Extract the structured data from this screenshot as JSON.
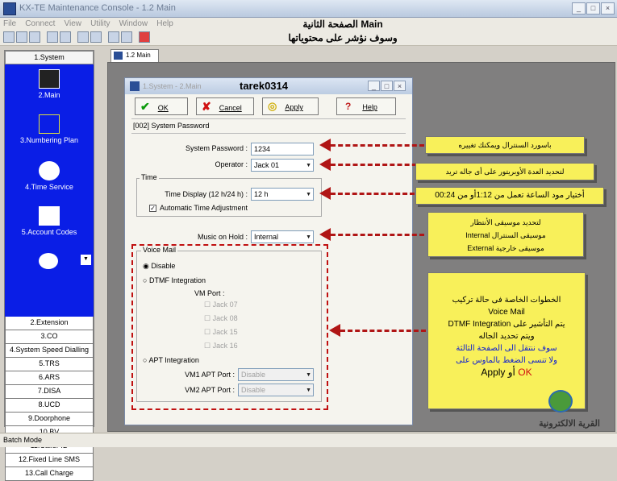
{
  "window": {
    "title": "KX-TE Maintenance Console - 1.2 Main"
  },
  "menu": [
    "File",
    "Connect",
    "View",
    "Utility",
    "Window",
    "Help"
  ],
  "overlay": {
    "line1": "الصفحة الثانية Main",
    "line2": "وسوف نؤشر على محتوياتها"
  },
  "sidebar": {
    "header": "1.System",
    "blue_items": [
      "2.Main",
      "3.Numbering Plan",
      "4.Time Service",
      "5.Account Codes"
    ],
    "list_items": [
      "2.Extension",
      "3.CO",
      "4.System Speed Dialling",
      "5.TRS",
      "6.ARS",
      "7.DISA",
      "8.UCD",
      "9.Doorphone",
      "10.BV",
      "11.Caller ID",
      "12.Fixed Line SMS",
      "13.Call Charge"
    ]
  },
  "tab": {
    "label": "1.2 Main"
  },
  "dialog": {
    "title": "1.System - 2.Main",
    "user": "tarek0314",
    "buttons": {
      "ok": "OK",
      "cancel": "Cancel",
      "apply": "Apply",
      "help": "Help"
    },
    "section": "[002] System Password",
    "system_password": {
      "label": "System Password :",
      "value": "1234"
    },
    "operator": {
      "label": "Operator :",
      "value": "Jack 01"
    },
    "time_group": "Time",
    "time_display": {
      "label": "Time Display (12 h/24 h) :",
      "value": "12 h"
    },
    "auto_time": "Automatic Time Adjustment",
    "music": {
      "label": "Music on Hold :",
      "value": "Internal"
    },
    "voice_mail": {
      "title": "Voice Mail",
      "disable": "Disable",
      "dtmf": "DTMF Integration",
      "vm_port": "VM Port :",
      "jacks": [
        "Jack 07",
        "Jack 08",
        "Jack 15",
        "Jack 16"
      ],
      "apt": "APT Integration",
      "vm1": "VM1 APT Port :",
      "vm2": "VM2 APT Port :",
      "port_value": "Disable"
    }
  },
  "notes": {
    "n1": "باسورد السنترال ويمكنك تغييره",
    "n2": "لتحديد العدة الأوبريتور على أى جاله تريد",
    "n3": "أختيار مود الساعة تعمل من 1:12أو من 00:24",
    "n4": [
      "لتحديد موسيقى الأنتظار",
      "موسيقى السنترال Internal",
      "موسيقى خارجية External"
    ],
    "n5a": [
      "الخطوات الخاصة فى حالة تركيب",
      "Voice Mail",
      "يتم التأشير على DTMF Integration",
      "ويتم تحديد الجاله"
    ],
    "n5b": [
      "سوف ننتقل الى الصفحة الثالثة",
      "ولا تنسى الضغط بالماوس على"
    ],
    "n5c": {
      "apply": "Apply",
      "or": "أو",
      "ok": "OK"
    }
  },
  "logo_text": "القرية الالكترونية",
  "status": "Batch Mode",
  "colors": {
    "sidebar_blue": "#0a1ee6",
    "note_yellow": "#f8f05a",
    "arrow_red": "#b01515"
  }
}
